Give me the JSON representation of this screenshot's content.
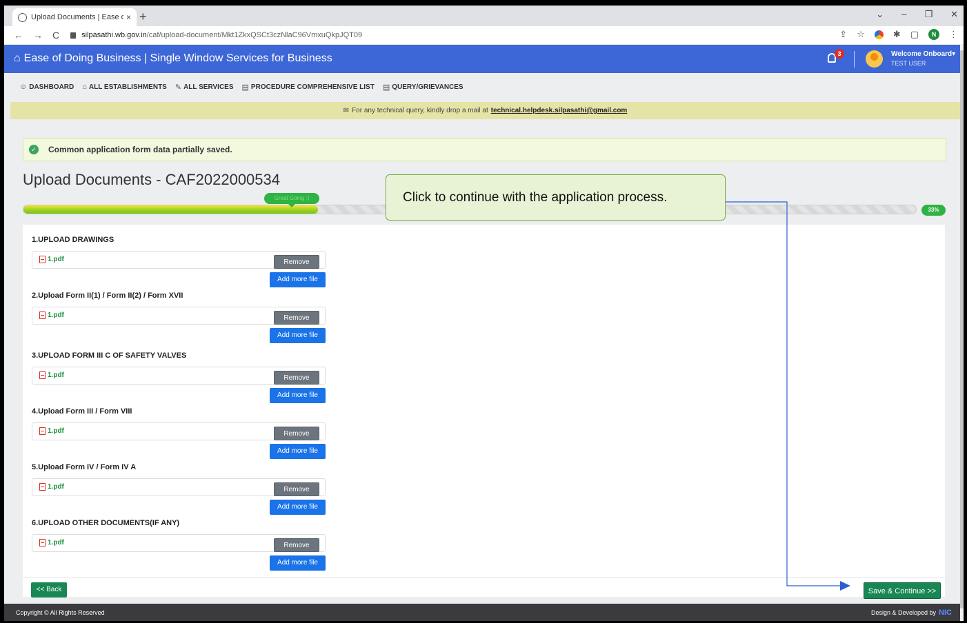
{
  "browser": {
    "tab_title": "Upload Documents | Ease of doi",
    "tab_close": "×",
    "new_tab": "+",
    "url_host": "silpasathi.wb.gov.in",
    "url_path": "/caf/upload-document/Mkt1ZkxQSCt3czNlaC96VmxuQkpJQT09",
    "profile_initial": "N"
  },
  "header": {
    "title": "Ease of Doing Business | Single Window Services for Business",
    "notification_count": "3",
    "user_greeting": "Welcome Onboard",
    "user_role": "TEST USER"
  },
  "menu": {
    "items": [
      {
        "icon": "☺",
        "label": "DASHBOARD"
      },
      {
        "icon": "⌂",
        "label": "ALL ESTABLISHMENTS"
      },
      {
        "icon": "✎",
        "label": "ALL SERVICES"
      },
      {
        "icon": "▤",
        "label": "PROCEDURE COMPREHENSIVE LIST"
      },
      {
        "icon": "▤",
        "label": "QUERY/GRIEVANCES"
      }
    ]
  },
  "notice": {
    "text": "For any technical query, kindly drop a mail at",
    "email": "technical.helpdesk.silpasathi@gmail.com"
  },
  "alert": {
    "message": "Common application form data partially saved."
  },
  "page": {
    "title": "Upload Documents - CAF2022000534"
  },
  "progress": {
    "percent": 33,
    "label": "33%",
    "pill_text": "Great Going :)"
  },
  "sections": [
    {
      "title": "1.UPLOAD DRAWINGS",
      "file": "1.pdf",
      "remove_label": "Remove",
      "add_label": "Add more file"
    },
    {
      "title": "2.Upload Form II(1) / Form II(2) / Form XVII",
      "file": "1.pdf",
      "remove_label": "Remove",
      "add_label": "Add more file"
    },
    {
      "title": "3.UPLOAD FORM III C OF SAFETY VALVES",
      "file": "1.pdf",
      "remove_label": "Remove",
      "add_label": "Add more file"
    },
    {
      "title": "4.Upload Form III / Form VIII",
      "file": "1.pdf",
      "remove_label": "Remove",
      "add_label": "Add more file"
    },
    {
      "title": "5.Upload Form IV / Form IV A",
      "file": "1.pdf",
      "remove_label": "Remove",
      "add_label": "Add more file"
    },
    {
      "title": "6.UPLOAD OTHER DOCUMENTS(IF ANY)",
      "file": "1.pdf",
      "remove_label": "Remove",
      "add_label": "Add more file"
    }
  ],
  "actions": {
    "back_label": "<< Back",
    "save_label": "Save & Continue >>"
  },
  "footer": {
    "copyright": "Copyright © All Rights Reserved",
    "credit": "Design & Developed by",
    "credit_brand": "NIC"
  },
  "callout": {
    "text": "Click to continue with the application process."
  },
  "colors": {
    "header_bg": "#3d67d6",
    "accent_green": "#198754",
    "add_button": "#1a73e8",
    "notice_bg": "#e5e4a6",
    "callout_bg": "#e8f3d6"
  }
}
